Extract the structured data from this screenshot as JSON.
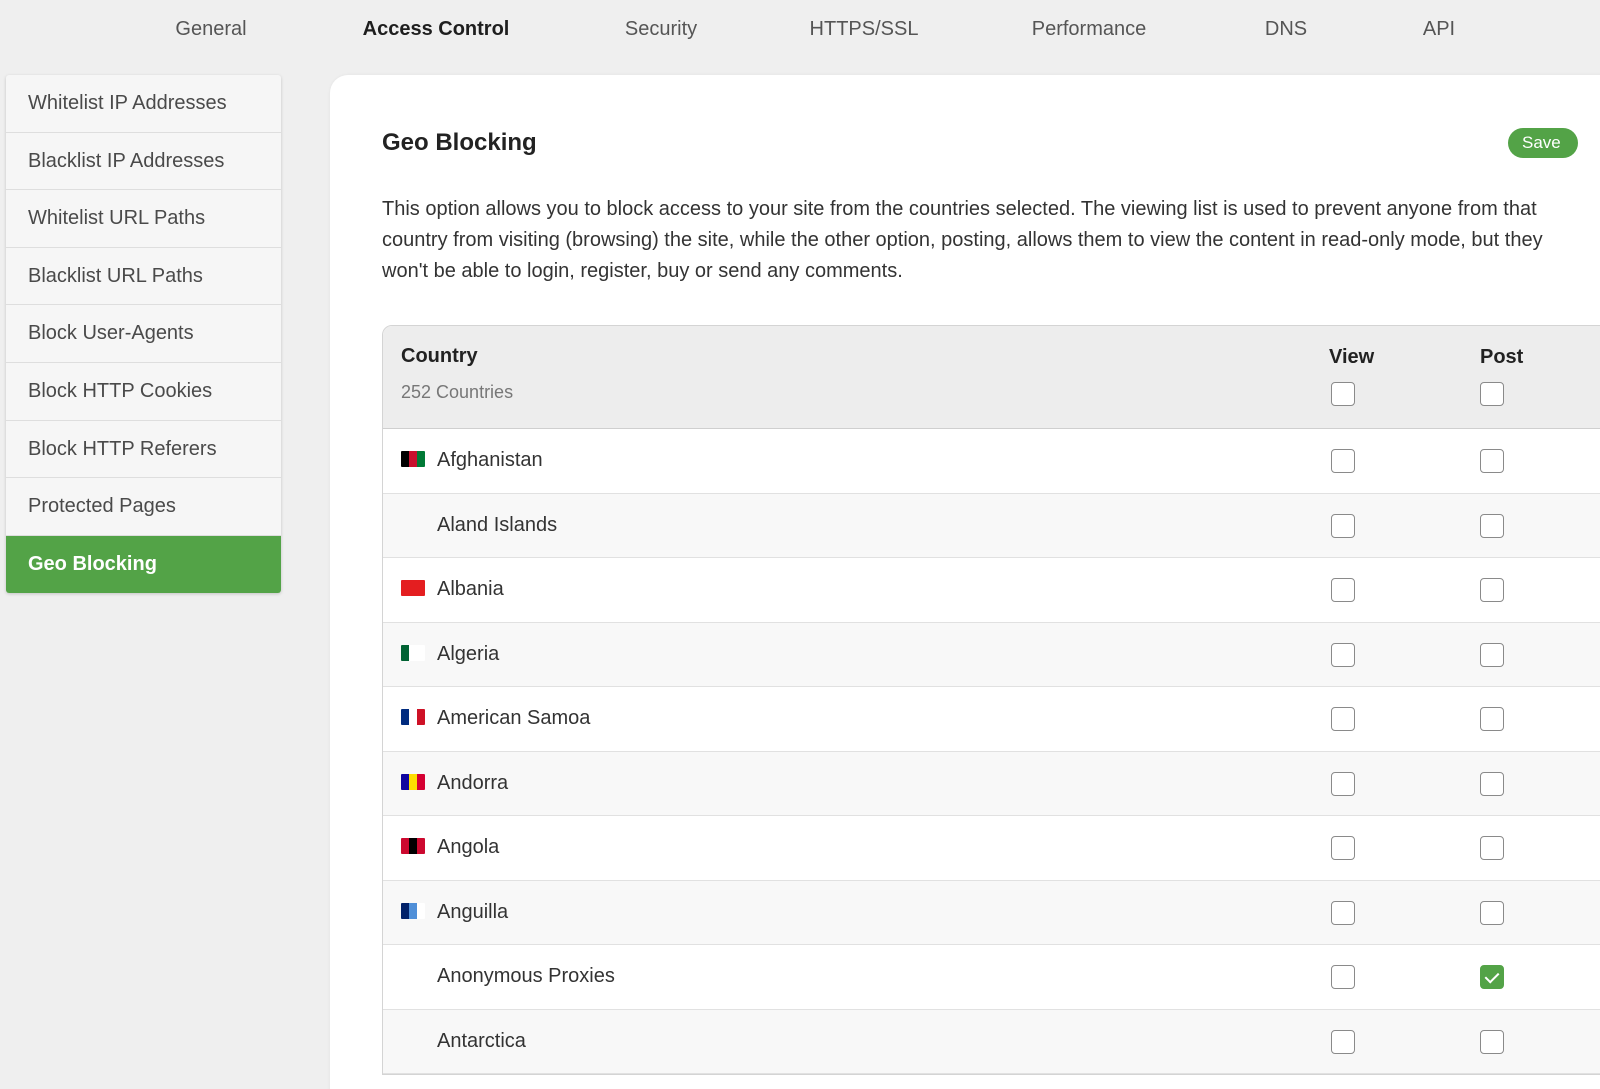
{
  "topnav": [
    {
      "label": "General",
      "active": false
    },
    {
      "label": "Access Control",
      "active": true
    },
    {
      "label": "Security",
      "active": false
    },
    {
      "label": "HTTPS/SSL",
      "active": false
    },
    {
      "label": "Performance",
      "active": false
    },
    {
      "label": "DNS",
      "active": false
    },
    {
      "label": "API",
      "active": false
    }
  ],
  "sidebar": [
    {
      "label": "Whitelist IP Addresses",
      "active": false
    },
    {
      "label": "Blacklist IP Addresses",
      "active": false
    },
    {
      "label": "Whitelist URL Paths",
      "active": false
    },
    {
      "label": "Blacklist URL Paths",
      "active": false
    },
    {
      "label": "Block User-Agents",
      "active": false
    },
    {
      "label": "Block HTTP Cookies",
      "active": false
    },
    {
      "label": "Block HTTP Referers",
      "active": false
    },
    {
      "label": "Protected Pages",
      "active": false
    },
    {
      "label": "Geo Blocking",
      "active": true
    }
  ],
  "panel": {
    "title": "Geo Blocking",
    "save_label": "Save",
    "description": "This option allows you to block access to your site from the countries selected. The viewing list is used to prevent anyone from that country from visiting (browsing) the site, while the other option, posting, allows them to view the content in read-only mode, but they won't be able to login, register, buy or send any comments."
  },
  "table": {
    "header_country": "Country",
    "header_count": "252 Countries",
    "header_view": "View",
    "header_post": "Post",
    "header_view_checked": false,
    "header_post_checked": false,
    "rows": [
      {
        "name": "Afghanistan",
        "flag": [
          "#000000",
          "#c8102e",
          "#007a36"
        ],
        "view": false,
        "post": false
      },
      {
        "name": "Aland Islands",
        "flag": null,
        "view": false,
        "post": false
      },
      {
        "name": "Albania",
        "flag": [
          "#e41e20",
          "#e41e20",
          "#e41e20"
        ],
        "view": false,
        "post": false
      },
      {
        "name": "Algeria",
        "flag": [
          "#006233",
          "#ffffff",
          "#ffffff"
        ],
        "view": false,
        "post": false
      },
      {
        "name": "American Samoa",
        "flag": [
          "#002b7f",
          "#ffffff",
          "#ce1126"
        ],
        "view": false,
        "post": false
      },
      {
        "name": "Andorra",
        "flag": [
          "#10069f",
          "#fedd00",
          "#d50032"
        ],
        "view": false,
        "post": false
      },
      {
        "name": "Angola",
        "flag": [
          "#cc092f",
          "#000000",
          "#cc092f"
        ],
        "view": false,
        "post": false
      },
      {
        "name": "Anguilla",
        "flag": [
          "#012169",
          "#4f8fd8",
          "#ffffff"
        ],
        "view": false,
        "post": false
      },
      {
        "name": "Anonymous Proxies",
        "flag": null,
        "view": false,
        "post": true
      },
      {
        "name": "Antarctica",
        "flag": null,
        "view": false,
        "post": false
      }
    ]
  },
  "colors": {
    "accent": "#53a347"
  }
}
